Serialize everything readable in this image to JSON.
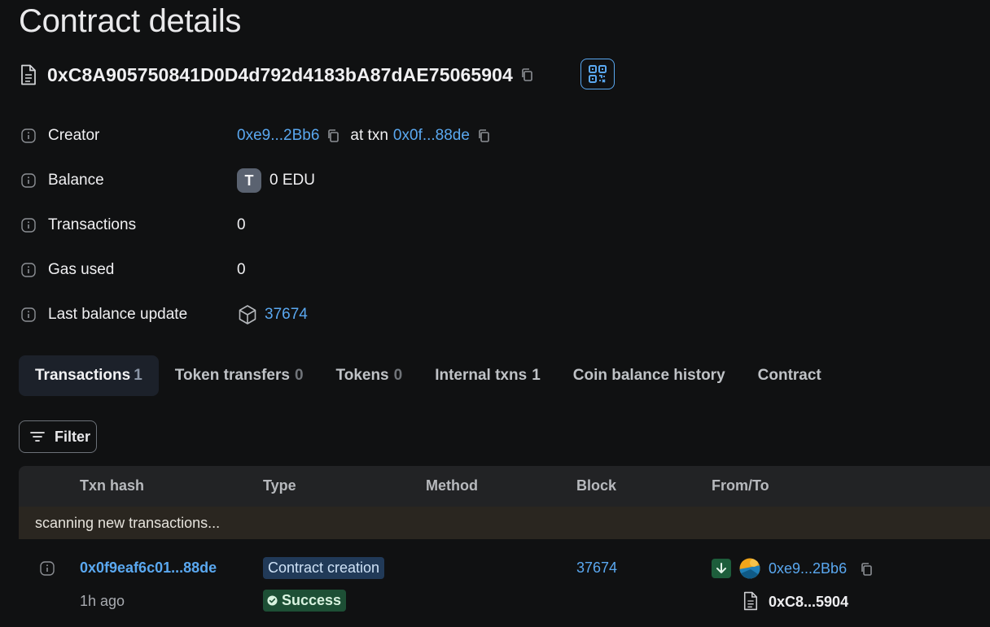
{
  "page": {
    "title": "Contract details"
  },
  "contract": {
    "address": "0xC8A905750841D0D4d792d4183bA87dAE75065904"
  },
  "details": {
    "creator": {
      "label": "Creator",
      "address": "0xe9...2Bb6",
      "at_txn_text": "at txn",
      "txn": "0x0f...88de"
    },
    "balance": {
      "label": "Balance",
      "token_letter": "T",
      "value": "0 EDU"
    },
    "transactions": {
      "label": "Transactions",
      "value": "0"
    },
    "gas_used": {
      "label": "Gas used",
      "value": "0"
    },
    "last_balance_update": {
      "label": "Last balance update",
      "block": "37674"
    }
  },
  "tabs": [
    {
      "label": "Transactions",
      "count": "1",
      "active": true
    },
    {
      "label": "Token transfers",
      "count": "0"
    },
    {
      "label": "Tokens",
      "count": "0"
    },
    {
      "label": "Internal txns",
      "count": "1"
    },
    {
      "label": "Coin balance history",
      "count": ""
    },
    {
      "label": "Contract",
      "count": ""
    }
  ],
  "filter": {
    "label": "Filter"
  },
  "table": {
    "columns": [
      "Txn hash",
      "Type",
      "Method",
      "Block",
      "From/To"
    ],
    "scanning_text": "scanning new transactions...",
    "rows": [
      {
        "hash": "0x0f9eaf6c01...88de",
        "age": "1h ago",
        "type": "Contract creation",
        "status": "Success",
        "method": "",
        "block": "37674",
        "from": "0xe9...2Bb6",
        "to": "0xC8...5904"
      }
    ]
  },
  "colors": {
    "link": "#5aa8f0",
    "background": "#101112",
    "success": "#1d4f35",
    "type_badge": "#213a58"
  }
}
